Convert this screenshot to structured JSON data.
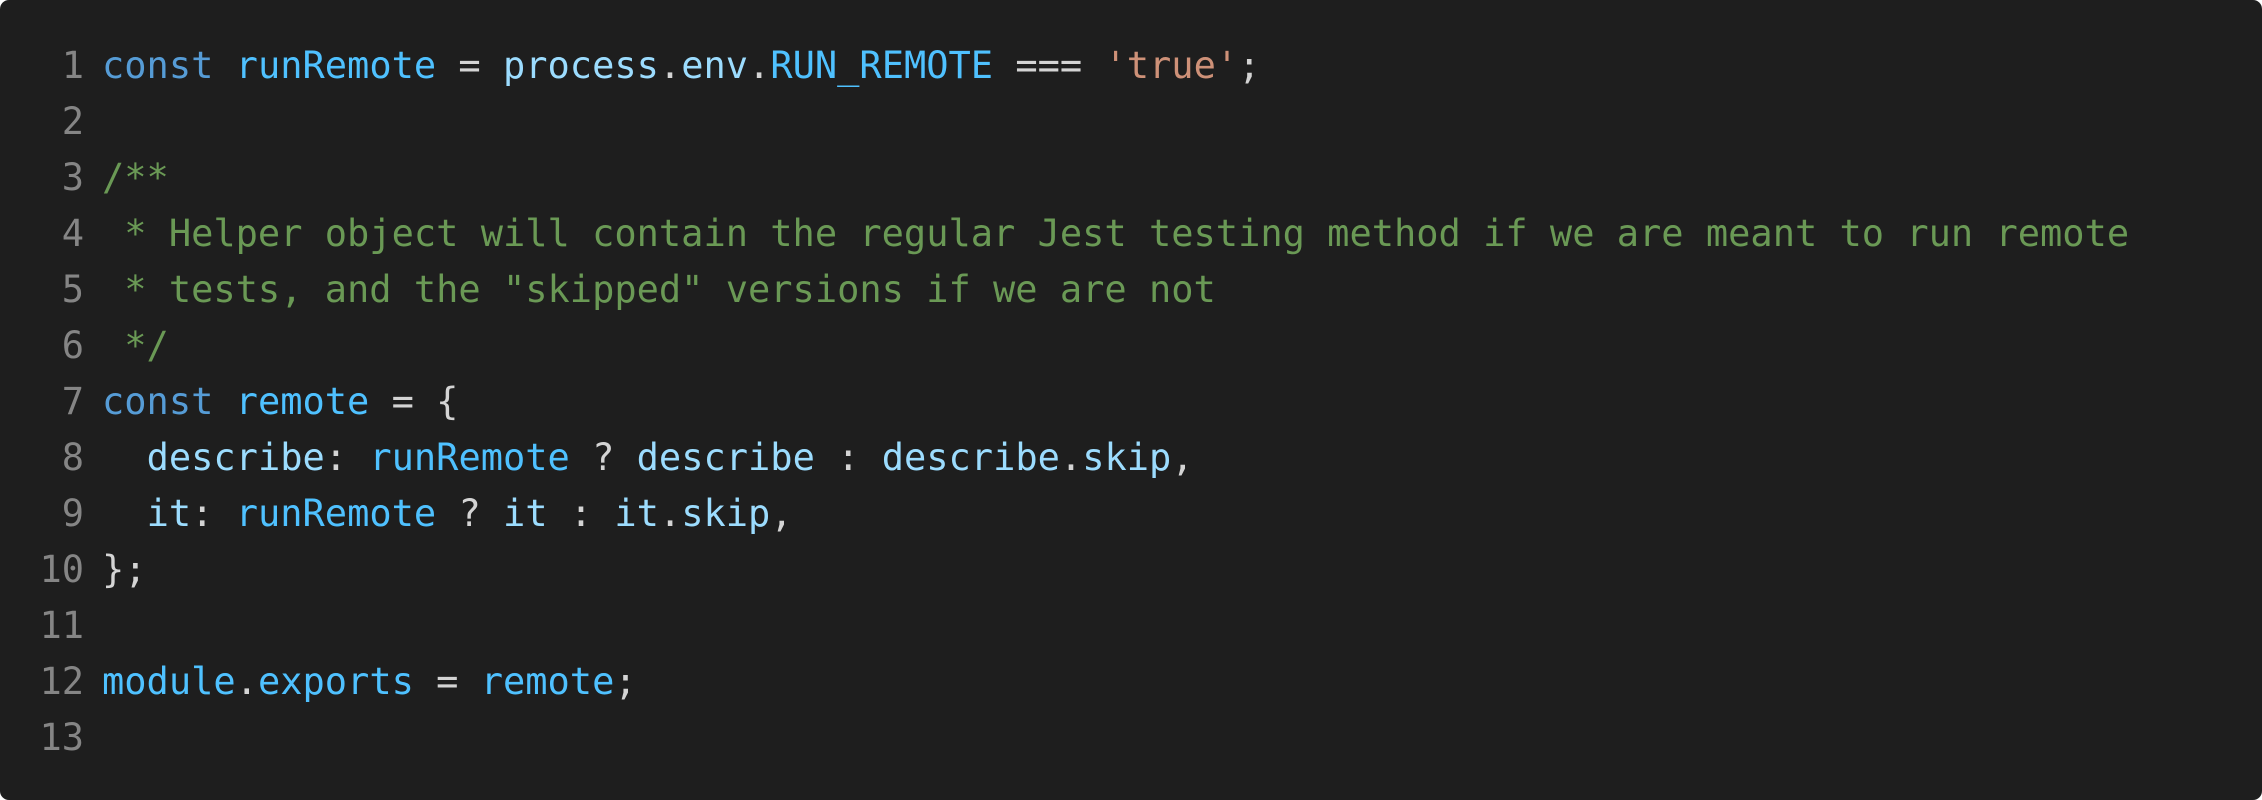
{
  "colors": {
    "background": "#1e1e1e",
    "line_number": "#858585",
    "keyword": "#569cd6",
    "identifier": "#4fc1ff",
    "property": "#9cdcfe",
    "string": "#ce9178",
    "comment": "#6a9955",
    "punctuation": "#d4d4d4"
  },
  "lines": [
    {
      "number": "1",
      "tokens": [
        {
          "t": "const",
          "c": "kw"
        },
        {
          "t": " ",
          "c": "pun"
        },
        {
          "t": "runRemote",
          "c": "id"
        },
        {
          "t": " = ",
          "c": "pun"
        },
        {
          "t": "process",
          "c": "prop"
        },
        {
          "t": ".",
          "c": "pun"
        },
        {
          "t": "env",
          "c": "prop"
        },
        {
          "t": ".",
          "c": "pun"
        },
        {
          "t": "RUN_REMOTE",
          "c": "id"
        },
        {
          "t": " === ",
          "c": "pun"
        },
        {
          "t": "'true'",
          "c": "str"
        },
        {
          "t": ";",
          "c": "pun"
        }
      ]
    },
    {
      "number": "2",
      "tokens": []
    },
    {
      "number": "3",
      "tokens": [
        {
          "t": "/**",
          "c": "cmt"
        }
      ]
    },
    {
      "number": "4",
      "tokens": [
        {
          "t": " * Helper object will contain the regular Jest testing method if we are meant to run remote",
          "c": "cmt"
        }
      ]
    },
    {
      "number": "5",
      "tokens": [
        {
          "t": " * tests, and the \"skipped\" versions if we are not",
          "c": "cmt"
        }
      ]
    },
    {
      "number": "6",
      "tokens": [
        {
          "t": " */",
          "c": "cmt"
        }
      ]
    },
    {
      "number": "7",
      "tokens": [
        {
          "t": "const",
          "c": "kw"
        },
        {
          "t": " ",
          "c": "pun"
        },
        {
          "t": "remote",
          "c": "id"
        },
        {
          "t": " = {",
          "c": "pun"
        }
      ]
    },
    {
      "number": "8",
      "tokens": [
        {
          "t": "  ",
          "c": "pun"
        },
        {
          "t": "describe",
          "c": "prop"
        },
        {
          "t": ": ",
          "c": "pun"
        },
        {
          "t": "runRemote",
          "c": "id"
        },
        {
          "t": " ? ",
          "c": "pun"
        },
        {
          "t": "describe",
          "c": "prop"
        },
        {
          "t": " : ",
          "c": "pun"
        },
        {
          "t": "describe",
          "c": "prop"
        },
        {
          "t": ".",
          "c": "pun"
        },
        {
          "t": "skip",
          "c": "prop"
        },
        {
          "t": ",",
          "c": "pun"
        }
      ]
    },
    {
      "number": "9",
      "tokens": [
        {
          "t": "  ",
          "c": "pun"
        },
        {
          "t": "it",
          "c": "prop"
        },
        {
          "t": ": ",
          "c": "pun"
        },
        {
          "t": "runRemote",
          "c": "id"
        },
        {
          "t": " ? ",
          "c": "pun"
        },
        {
          "t": "it",
          "c": "prop"
        },
        {
          "t": " : ",
          "c": "pun"
        },
        {
          "t": "it",
          "c": "prop"
        },
        {
          "t": ".",
          "c": "pun"
        },
        {
          "t": "skip",
          "c": "prop"
        },
        {
          "t": ",",
          "c": "pun"
        }
      ]
    },
    {
      "number": "10",
      "tokens": [
        {
          "t": "};",
          "c": "pun"
        }
      ]
    },
    {
      "number": "11",
      "tokens": []
    },
    {
      "number": "12",
      "tokens": [
        {
          "t": "module",
          "c": "id"
        },
        {
          "t": ".",
          "c": "pun"
        },
        {
          "t": "exports",
          "c": "id"
        },
        {
          "t": " = ",
          "c": "pun"
        },
        {
          "t": "remote",
          "c": "id"
        },
        {
          "t": ";",
          "c": "pun"
        }
      ]
    },
    {
      "number": "13",
      "tokens": []
    }
  ]
}
